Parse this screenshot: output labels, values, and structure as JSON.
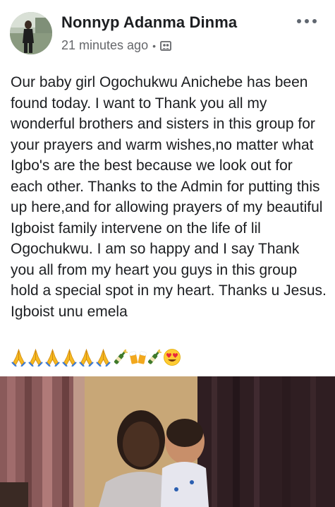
{
  "post": {
    "author": "Nonnyp Adanma Dinma",
    "timestamp": "21 minutes ago",
    "separator": "•",
    "privacy_icon": "group-privacy-icon",
    "more_icon": "more-options-icon",
    "text": "Our baby girl Ogochukwu Anichebe has been found today. I want to Thank you all my wonderful brothers and sisters in this group for your prayers and warm wishes,no matter what Igbo's are the best because we look out for each other. Thanks to the Admin for putting this up here,and for allowing prayers of my beautiful Igboist family intervene on the life of lil Ogochukwu. I am so happy and I say Thank you all from my heart you guys in this group hold a special spot in my heart. Thanks u Jesus. Igboist unu emela",
    "emojis": [
      "praying-hands",
      "praying-hands",
      "praying-hands",
      "praying-hands",
      "praying-hands",
      "praying-hands",
      "champagne-bottle",
      "clinking-beer-mugs",
      "champagne-bottle",
      "heart-eyes-face"
    ]
  },
  "colors": {
    "name": "#1c1e21",
    "meta": "#65676b",
    "body_text": "#1c1e21"
  }
}
